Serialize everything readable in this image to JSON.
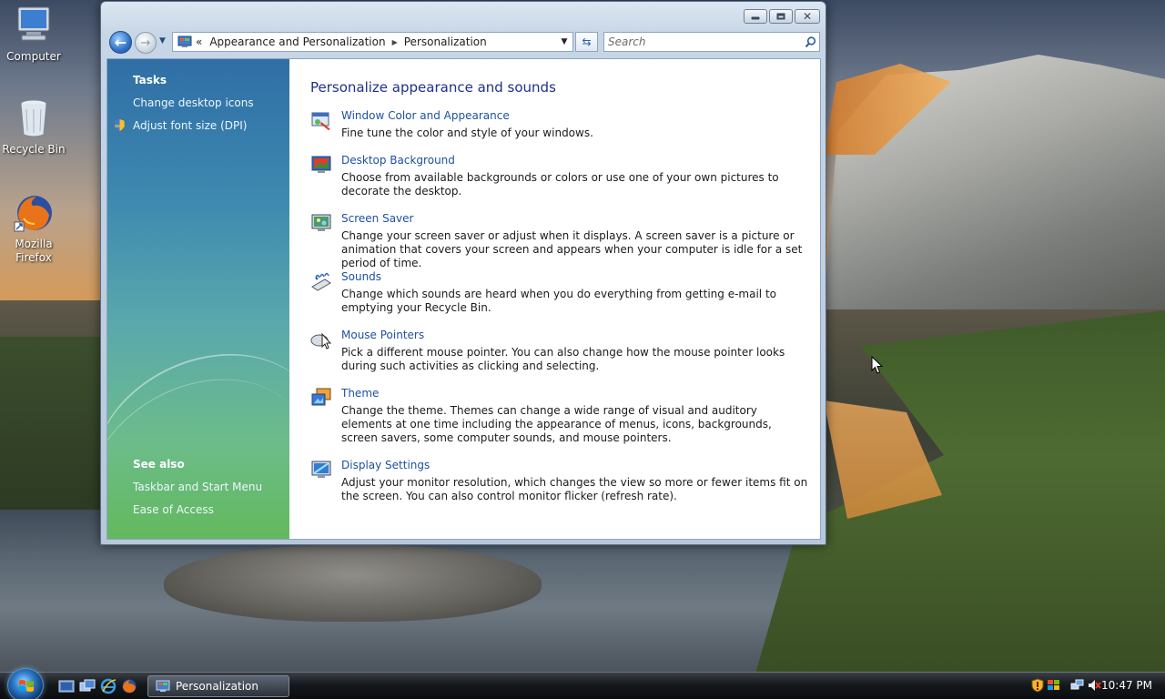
{
  "desktop": {
    "icons": [
      {
        "label": "Computer"
      },
      {
        "label": "Recycle Bin"
      },
      {
        "label": "Mozilla Firefox"
      }
    ]
  },
  "window": {
    "breadcrumb": {
      "overflow": "«",
      "items": [
        "Appearance and Personalization",
        "Personalization"
      ],
      "separator": "▶"
    },
    "search": {
      "placeholder": "Search"
    },
    "sidebar": {
      "tasks_heading": "Tasks",
      "tasks": [
        "Change desktop icons",
        "Adjust font size (DPI)"
      ],
      "see_also_heading": "See also",
      "see_also": [
        "Taskbar and Start Menu",
        "Ease of Access"
      ]
    },
    "main": {
      "title": "Personalize appearance and sounds",
      "items": [
        {
          "icon": "window-color-icon",
          "title": "Window Color and Appearance",
          "desc": "Fine tune the color and style of your windows."
        },
        {
          "icon": "desktop-background-icon",
          "title": "Desktop Background",
          "desc": "Choose from available backgrounds or colors or use one of your own pictures to decorate the desktop."
        },
        {
          "icon": "screen-saver-icon",
          "title": "Screen Saver",
          "desc": "Change your screen saver or adjust when it displays. A screen saver is a picture or animation that covers your screen and appears when your computer is idle for a set period of time."
        },
        {
          "icon": "sounds-icon",
          "title": "Sounds",
          "desc": "Change which sounds are heard when you do everything from getting e-mail to emptying your Recycle Bin."
        },
        {
          "icon": "mouse-pointers-icon",
          "title": "Mouse Pointers",
          "desc": "Pick a different mouse pointer. You can also change how the mouse pointer looks during such activities as clicking and selecting."
        },
        {
          "icon": "theme-icon",
          "title": "Theme",
          "desc": "Change the theme. Themes can change a wide range of visual and auditory elements at one time including the appearance of menus, icons, backgrounds, screen savers, some computer sounds, and mouse pointers."
        },
        {
          "icon": "display-settings-icon",
          "title": "Display Settings",
          "desc": "Adjust your monitor resolution, which changes the view so more or fewer items fit on the screen. You can also control monitor flicker (refresh rate)."
        }
      ]
    }
  },
  "taskbar": {
    "active_task": "Personalization",
    "clock": "10:47 PM"
  },
  "colors": {
    "link": "#1e50a2",
    "title": "#1e3287",
    "sidebar_top": "#2f6ea6",
    "sidebar_bottom": "#63b95d"
  }
}
